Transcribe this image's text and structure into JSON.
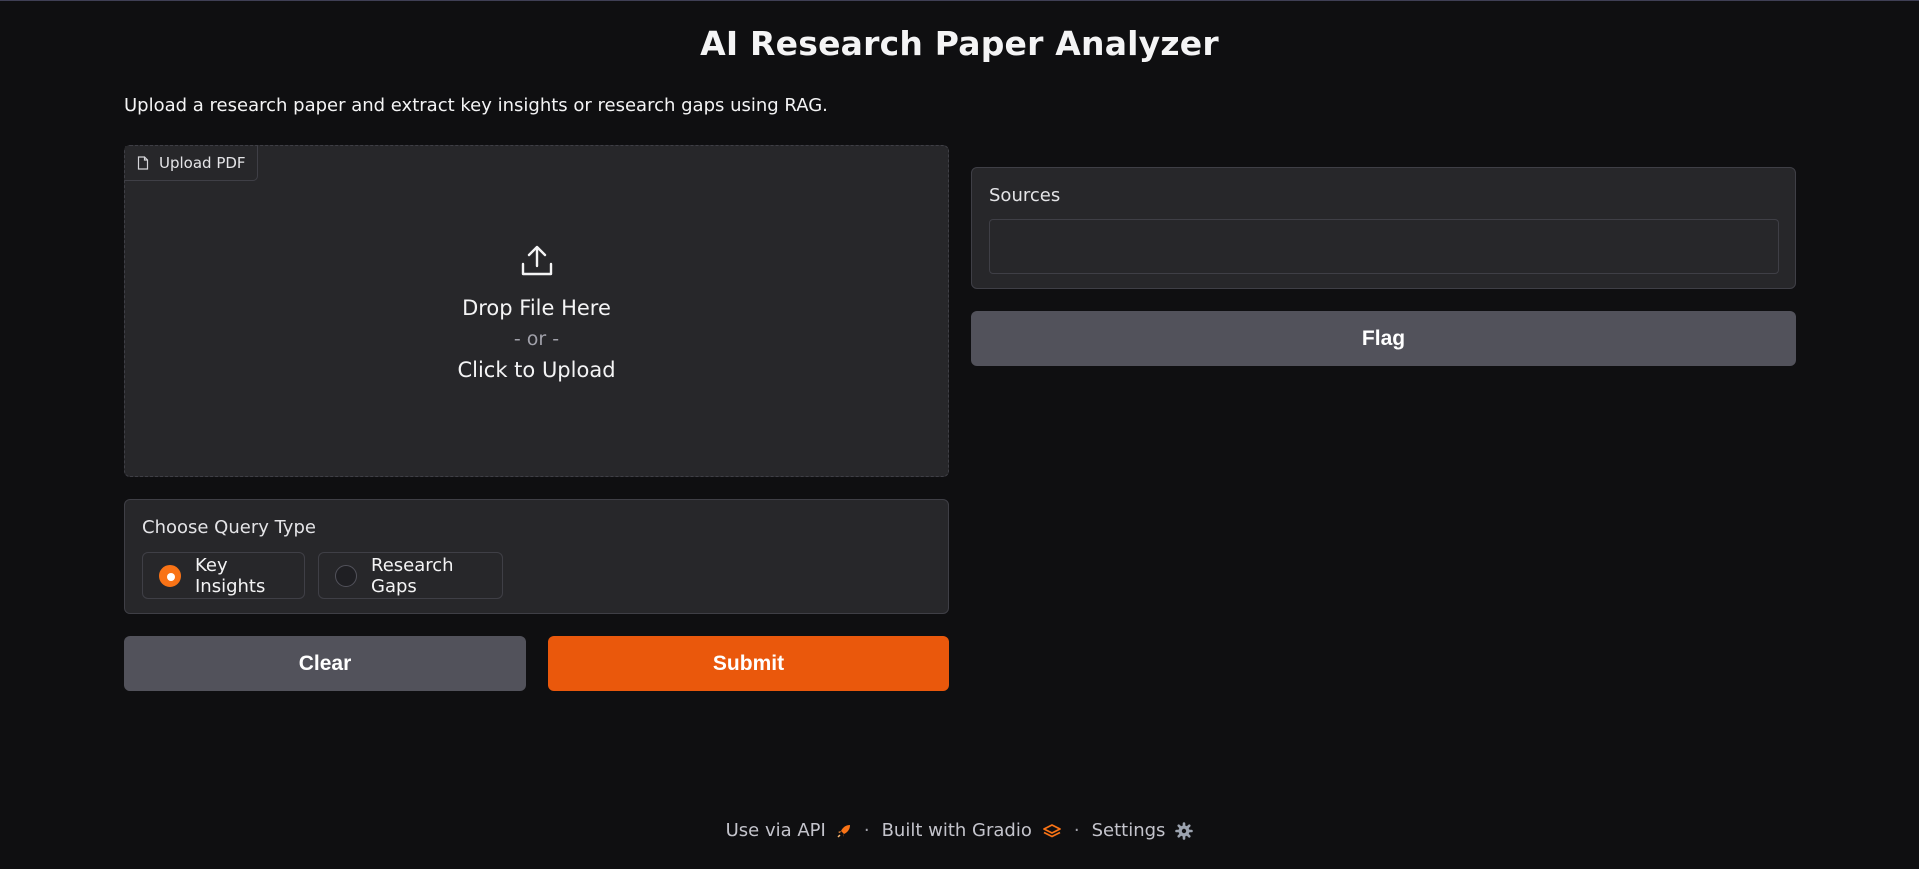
{
  "app": {
    "title": "AI Research Paper Analyzer",
    "description": "Upload a research paper and extract key insights or research gaps using RAG."
  },
  "upload": {
    "label": "Upload PDF",
    "drop_text": "Drop File Here",
    "or_text": "- or -",
    "click_text": "Click to Upload",
    "label_icon": "file-icon",
    "center_icon": "upload-icon"
  },
  "query": {
    "label": "Choose Query Type",
    "options": [
      {
        "label": "Key Insights",
        "checked": true
      },
      {
        "label": "Research Gaps",
        "checked": false
      }
    ]
  },
  "buttons": {
    "clear": "Clear",
    "submit": "Submit",
    "flag": "Flag"
  },
  "sources": {
    "label": "Sources",
    "value": ""
  },
  "footer": {
    "api": "Use via API",
    "built": "Built with Gradio",
    "settings": "Settings",
    "separator": "·"
  },
  "colors": {
    "background": "#0f0f11",
    "panel": "#27272a",
    "accent": "#ea580c",
    "secondary_button": "#52525b"
  }
}
